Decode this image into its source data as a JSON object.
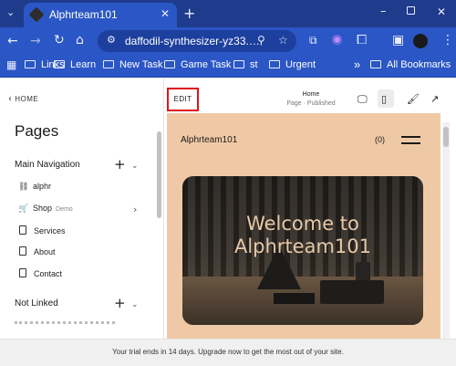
{
  "browser": {
    "tab_title": "Alphrteam101",
    "new_tab_symbol": "+",
    "url": "daffodil-synthesizer-yz33.squ...",
    "bookmarks": [
      {
        "label": "Links"
      },
      {
        "label": "Learn"
      },
      {
        "label": "New Task"
      },
      {
        "label": "Game Task"
      },
      {
        "label": "st"
      },
      {
        "label": "Urgent"
      }
    ],
    "more_bookmarks_symbol": "»",
    "all_bookmarks": "All Bookmarks"
  },
  "sidebar": {
    "back_label": "HOME",
    "title": "Pages",
    "main_nav_label": "Main Navigation",
    "items": [
      {
        "label": "alphr",
        "icon": "link-icon"
      },
      {
        "label": "Shop",
        "tag": "Demo",
        "icon": "cart-icon"
      },
      {
        "label": "Services",
        "icon": "page-icon"
      },
      {
        "label": "About",
        "icon": "page-icon"
      },
      {
        "label": "Contact",
        "icon": "page-icon"
      }
    ],
    "not_linked_label": "Not Linked"
  },
  "editor": {
    "edit_label": "EDIT",
    "page_name": "Home",
    "page_status": "Page · Published"
  },
  "site": {
    "name": "Alphrteam101",
    "cart": "(0)",
    "hero_title": "Welcome to Alphrteam101"
  },
  "trial_message": "Your trial ends in 14 days. Upgrade now to get the most out of your site.",
  "colors": {
    "browser_accent": "#2b56c5",
    "preview_bg": "#efc9a6",
    "edit_highlight": "#e0141b"
  }
}
